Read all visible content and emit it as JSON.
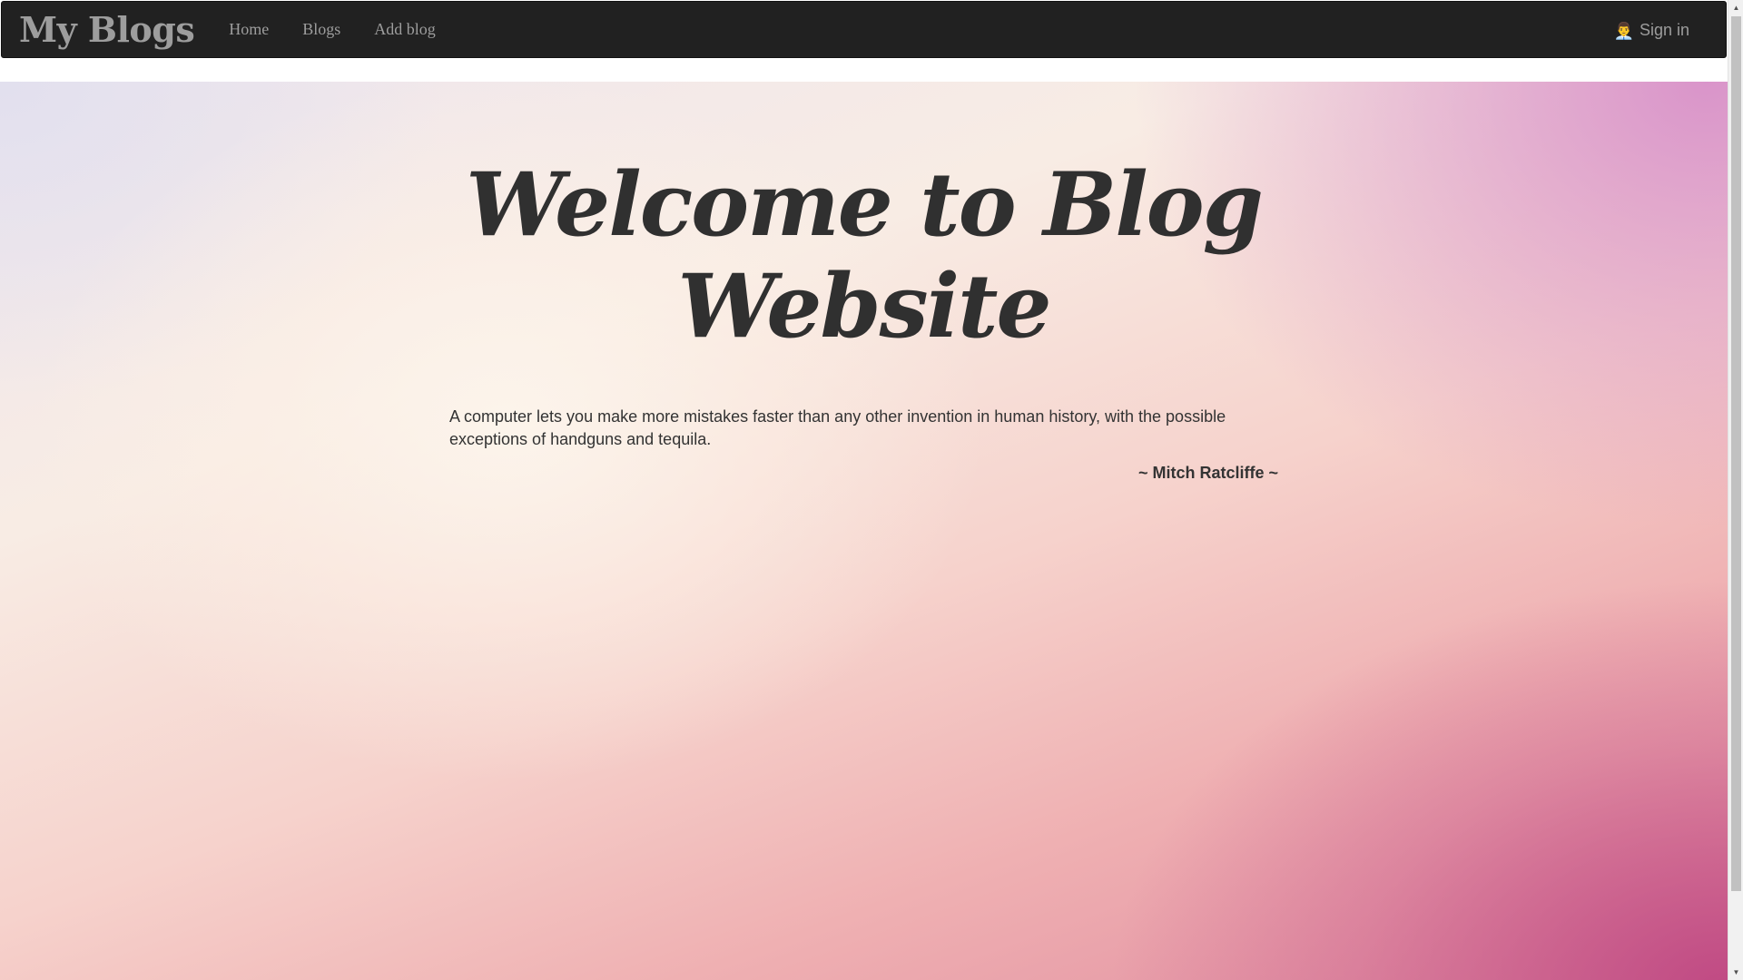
{
  "navbar": {
    "brand": "My Blogs",
    "links": [
      {
        "label": "Home"
      },
      {
        "label": "Blogs"
      },
      {
        "label": "Add blog"
      }
    ],
    "signin": {
      "icon": "user-icon",
      "icon_glyph": "👨‍💼",
      "label": "Sign in"
    }
  },
  "hero": {
    "title_line1": "Welcome to Blog",
    "title_line2": "Website",
    "quote": "A computer lets you make more mistakes faster than any other invention in human history, with the possible exceptions of handguns and tequila.",
    "author": "~ Mitch Ratcliffe ~"
  },
  "colors": {
    "navbar_bg": "#212121",
    "nav_text": "#9d9d9d",
    "title_text": "#303030",
    "body_text": "#333333"
  }
}
